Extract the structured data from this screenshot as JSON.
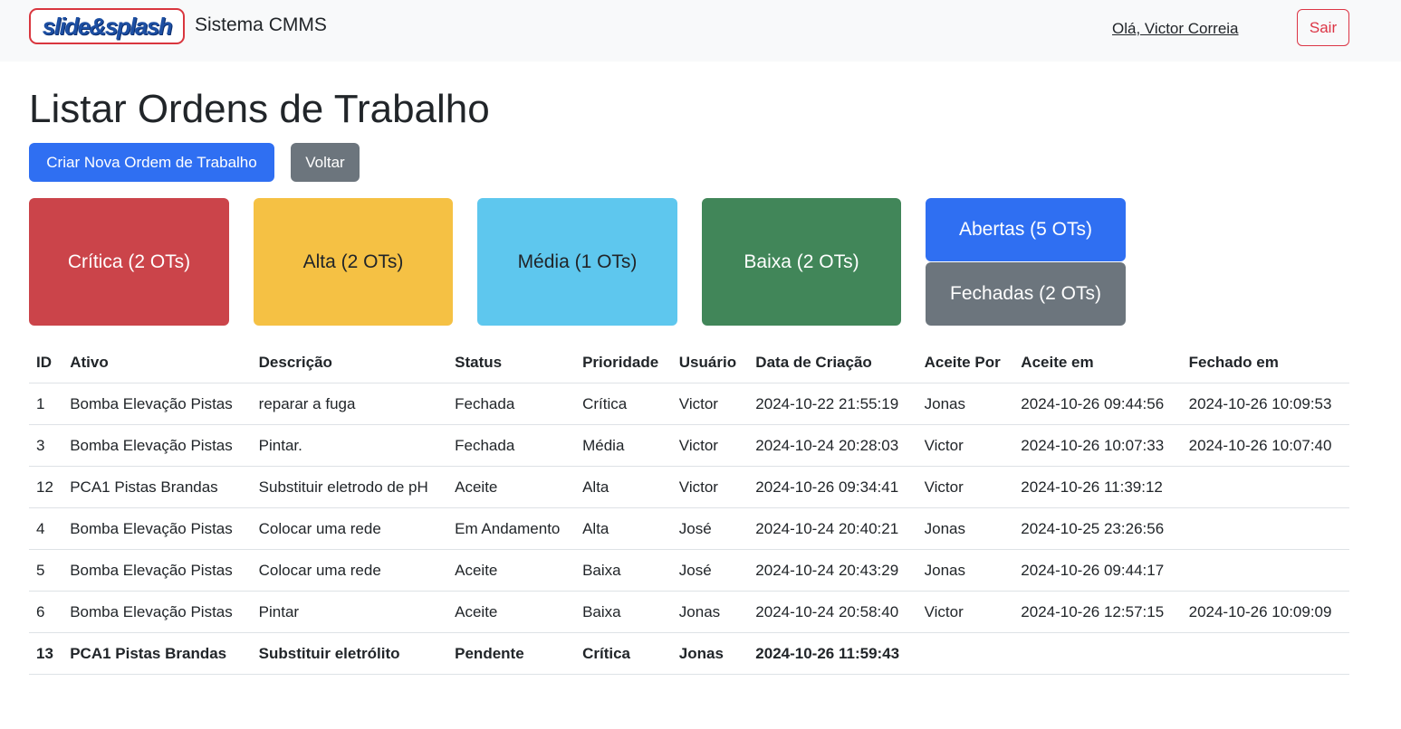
{
  "navbar": {
    "logo_text": "slide&splash",
    "brand": "Sistema CMMS",
    "user_greeting": "Olá, Victor Correia",
    "logout_label": "Sair"
  },
  "page": {
    "title": "Listar Ordens de Trabalho",
    "create_button": "Criar Nova Ordem de Trabalho",
    "back_button": "Voltar"
  },
  "cards": {
    "critica": "Crítica (2 OTs)",
    "alta": "Alta (2 OTs)",
    "media": "Média (1 OTs)",
    "baixa": "Baixa (2 OTs)",
    "abertas": "Abertas (5 OTs)",
    "fechadas": "Fechadas (2 OTs)"
  },
  "colors": {
    "critica": "#cb444a",
    "alta": "#f5c144",
    "media": "#5ec7ee",
    "baixa": "#418659",
    "abertas": "#2f6ff2",
    "fechadas": "#6c757d"
  },
  "table": {
    "headers": [
      "ID",
      "Ativo",
      "Descrição",
      "Status",
      "Prioridade",
      "Usuário",
      "Data de Criação",
      "Aceite Por",
      "Aceite em",
      "Fechado em"
    ],
    "rows": [
      [
        "1",
        "Bomba Elevação Pistas",
        "reparar a fuga",
        "Fechada",
        "Crítica",
        "Victor",
        "2024-10-22 21:55:19",
        "Jonas",
        "2024-10-26 09:44:56",
        "2024-10-26 10:09:53"
      ],
      [
        "3",
        "Bomba Elevação Pistas",
        "Pintar.",
        "Fechada",
        "Média",
        "Victor",
        "2024-10-24 20:28:03",
        "Victor",
        "2024-10-26 10:07:33",
        "2024-10-26 10:07:40"
      ],
      [
        "12",
        "PCA1 Pistas Brandas",
        "Substituir eletrodo de pH",
        "Aceite",
        "Alta",
        "Victor",
        "2024-10-26 09:34:41",
        "Victor",
        "2024-10-26 11:39:12",
        ""
      ],
      [
        "4",
        "Bomba Elevação Pistas",
        "Colocar uma rede",
        "Em Andamento",
        "Alta",
        "José",
        "2024-10-24 20:40:21",
        "Jonas",
        "2024-10-25 23:26:56",
        ""
      ],
      [
        "5",
        "Bomba Elevação Pistas",
        "Colocar uma rede",
        "Aceite",
        "Baixa",
        "José",
        "2024-10-24 20:43:29",
        "Jonas",
        "2024-10-26 09:44:17",
        ""
      ],
      [
        "6",
        "Bomba Elevação Pistas",
        "Pintar",
        "Aceite",
        "Baixa",
        "Jonas",
        "2024-10-24 20:58:40",
        "Victor",
        "2024-10-26 12:57:15",
        "2024-10-26 10:09:09"
      ],
      [
        "13",
        "PCA1 Pistas Brandas",
        "Substituir eletrólito",
        "Pendente",
        "Crítica",
        "Jonas",
        "2024-10-26 11:59:43",
        "",
        "",
        ""
      ]
    ],
    "bold_rows": [
      6
    ]
  }
}
